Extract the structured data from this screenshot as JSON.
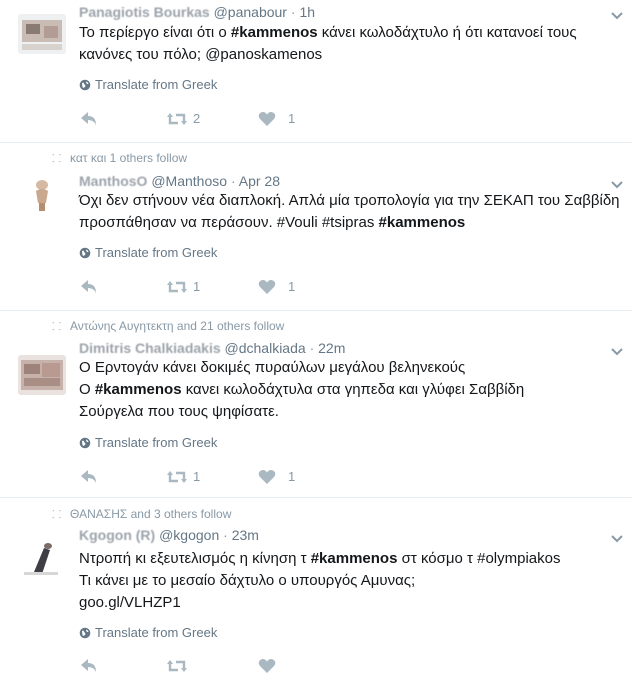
{
  "colors": {
    "text": "#14171a",
    "muted": "#657786",
    "icon": "#8899a6",
    "divider": "#e6ecf0"
  },
  "icons": {
    "reply": "reply-arrow-icon",
    "retweet": "retweet-arrows-icon",
    "like": "heart-icon",
    "translate": "globe-icon",
    "more": "chevron-down-icon",
    "context": "follow-context-icon"
  },
  "tweets": [
    {
      "context": "",
      "name": "Panagiotis Bourkas",
      "handle": "@panabour",
      "time": "1h",
      "lines": [
        [
          {
            "t": "Το περίεργο είναι ότι ο "
          },
          {
            "t": "#kammenos",
            "b": true
          },
          {
            "t": " κάνει κωλοδάχτυλο ή ότι κατανοεί τους"
          }
        ],
        [
          {
            "t": "κανόνες του πόλο; @panoskamenos"
          }
        ]
      ],
      "translate": "Translate from Greek",
      "retweets": "2",
      "likes": "1"
    },
    {
      "context": "κατ και 1 others follow",
      "name": "ManthosO",
      "handle": "@Manthoso",
      "time": "Apr 28",
      "lines": [
        [
          {
            "t": "Όχι δεν στήνουν νέα διαπλοκή. Απλά μία τροπολογία για την ΣΕΚΑΠ του Σαββίδη"
          }
        ],
        [
          {
            "t": "προσπάθησαν να περάσουν. #Vouli #tsipras "
          },
          {
            "t": "#kammenos",
            "b": true
          }
        ]
      ],
      "translate": "Translate from Greek",
      "retweets": "1",
      "likes": "1"
    },
    {
      "context": "Αντώνης Αυγητεκτη and 21 others follow",
      "name": "Dimitris Chalkiadakis",
      "handle": "@dchalkiada",
      "time": "22m",
      "lines": [
        [
          {
            "t": "Ο Ερντογάν κάνει δοκιμές πυραύλων μεγάλου βεληνεκούς"
          }
        ],
        [
          {
            "t": "Ο "
          },
          {
            "t": "#kammenos",
            "b": true
          },
          {
            "t": " κανει κωλοδάχτυλα στα γηπεδα και γλύφει Σαββίδη"
          }
        ],
        [
          {
            "t": "Σούργελα που τους ψηφίσατε."
          }
        ]
      ],
      "translate": "Translate from Greek",
      "retweets": "1",
      "likes": "1"
    },
    {
      "context": "ΘΑΝΑΣΗΣ and 3 others follow",
      "name": "Kgogon (R)",
      "handle": "@kgogon",
      "time": "23m",
      "lines": [
        [
          {
            "t": "Ντροπή κι εξευτελισμός η κίνηση τ "
          },
          {
            "t": "#kammenos",
            "b": true
          },
          {
            "t": " στ κόσμο τ #olympiakos"
          }
        ],
        [
          {
            "t": "Τι κάνει με το μεσαίο δάχτυλο ο υπουργός Αμυνας;"
          }
        ],
        [
          {
            "t": "goo.gl/VLHZP1"
          }
        ]
      ],
      "translate": "Translate from Greek",
      "retweets": "",
      "likes": ""
    }
  ]
}
